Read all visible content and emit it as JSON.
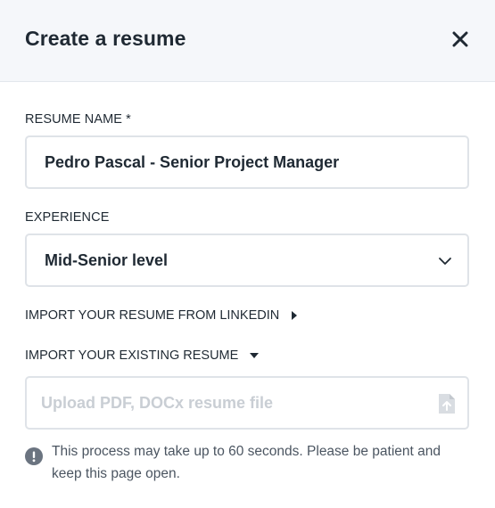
{
  "dialog": {
    "title": "Create a resume",
    "close_icon": "close-icon"
  },
  "form": {
    "resume_name": {
      "label": "RESUME NAME *",
      "value": "Pedro Pascal - Senior Project Manager"
    },
    "experience": {
      "label": "EXPERIENCE",
      "selected": "Mid-Senior level",
      "icon": "chevron-down-icon"
    },
    "import_linkedin": {
      "label": "IMPORT YOUR RESUME FROM LINKEDIN",
      "icon": "caret-right-icon",
      "expanded": false
    },
    "import_existing": {
      "label": "IMPORT YOUR EXISTING RESUME",
      "icon": "caret-down-icon",
      "expanded": true
    },
    "upload": {
      "placeholder": "Upload PDF, DOCx resume file",
      "icon": "upload-file-icon"
    }
  },
  "notice": {
    "icon": "info-icon",
    "text": "This process may take up to 60 seconds. Please be patient and keep this page open."
  },
  "colors": {
    "header_bg": "#f5f7fa",
    "text": "#1f2933",
    "border": "#dfe3e8",
    "placeholder": "#c9ced4",
    "muted_text": "#4b5561"
  }
}
